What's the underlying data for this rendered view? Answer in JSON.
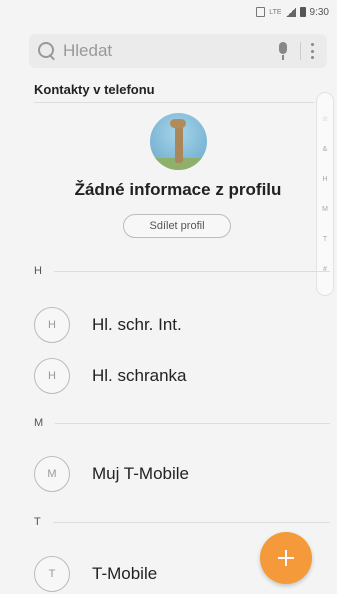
{
  "status_bar": {
    "lte": "LTE",
    "time": "9:30"
  },
  "search": {
    "placeholder": "Hledat"
  },
  "section": {
    "title": "Kontakty v telefonu"
  },
  "index": [
    "☆",
    "&",
    "H",
    "M",
    "T",
    "#"
  ],
  "profile": {
    "name": "Žádné informace z profilu",
    "share_label": "Sdílet profil"
  },
  "groups": [
    {
      "letter": "H",
      "contacts": [
        {
          "initial": "H",
          "name": "Hl. schr. Int."
        },
        {
          "initial": "H",
          "name": "Hl. schranka"
        }
      ]
    },
    {
      "letter": "M",
      "contacts": [
        {
          "initial": "M",
          "name": "Muj T-Mobile"
        }
      ]
    },
    {
      "letter": "T",
      "contacts": [
        {
          "initial": "T",
          "name": "T-Mobile"
        }
      ]
    }
  ],
  "colors": {
    "fab": "#f49a3a",
    "background": "#f4f4f4"
  },
  "fab_icon": "plus-icon"
}
